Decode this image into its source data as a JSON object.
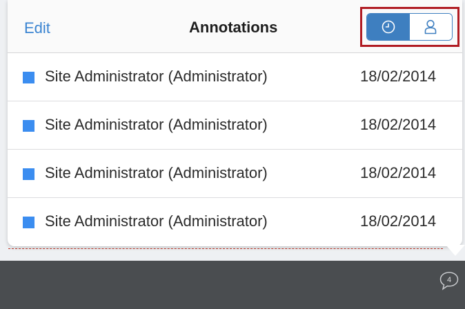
{
  "header": {
    "edit_label": "Edit",
    "title": "Annotations",
    "sort_options": [
      {
        "icon": "clock-icon",
        "selected": true
      },
      {
        "icon": "user-icon",
        "selected": false
      }
    ]
  },
  "annotations": [
    {
      "author": "Site Administrator (Administrator)",
      "date": "18/02/2014",
      "color": "#3b8df0"
    },
    {
      "author": "Site Administrator (Administrator)",
      "date": "18/02/2014",
      "color": "#3b8df0"
    },
    {
      "author": "Site Administrator (Administrator)",
      "date": "18/02/2014",
      "color": "#3b8df0"
    },
    {
      "author": "Site Administrator (Administrator)",
      "date": "18/02/2014",
      "color": "#3b8df0"
    }
  ],
  "comments": {
    "count": "4",
    "icon": "speech-bubble-icon"
  },
  "colors": {
    "accent": "#3e7fc0",
    "link": "#3a84d1",
    "highlight_border": "#b01b22",
    "toolbar": "#4a4d50"
  }
}
